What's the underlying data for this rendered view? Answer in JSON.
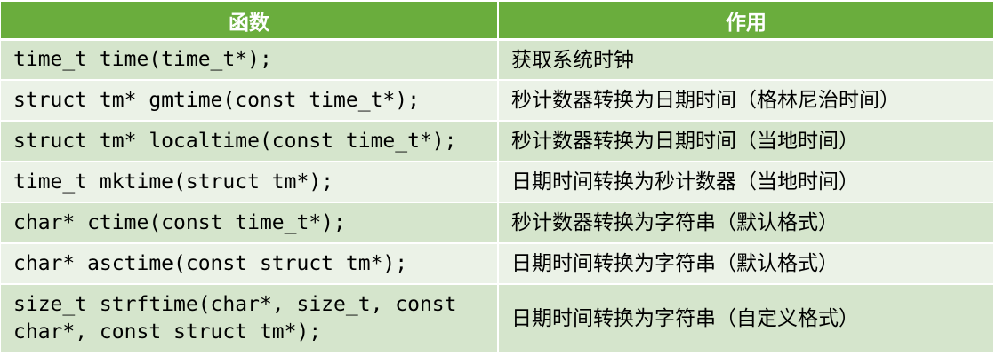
{
  "header": {
    "function_label": "函数",
    "purpose_label": "作用"
  },
  "rows": [
    {
      "function": "time_t time(time_t*);",
      "purpose": "获取系统时钟"
    },
    {
      "function": "struct tm* gmtime(const time_t*);",
      "purpose": "秒计数器转换为日期时间（格林尼治时间）"
    },
    {
      "function": "struct tm* localtime(const time_t*);",
      "purpose": "秒计数器转换为日期时间（当地时间）"
    },
    {
      "function": "time_t mktime(struct tm*);",
      "purpose": "日期时间转换为秒计数器（当地时间）"
    },
    {
      "function": "char* ctime(const time_t*);",
      "purpose": "秒计数器转换为字符串（默认格式）"
    },
    {
      "function": "char* asctime(const struct tm*);",
      "purpose": "日期时间转换为字符串（默认格式）"
    },
    {
      "function": "size_t strftime(char*, size_t, const\nchar*, const struct tm*);",
      "purpose": "日期时间转换为字符串（自定义格式）"
    }
  ],
  "colors": {
    "header_bg": "#6aad3d",
    "header_text": "#ffffff",
    "row_dark": "#d5e5cc",
    "row_light": "#ebf2e7"
  }
}
